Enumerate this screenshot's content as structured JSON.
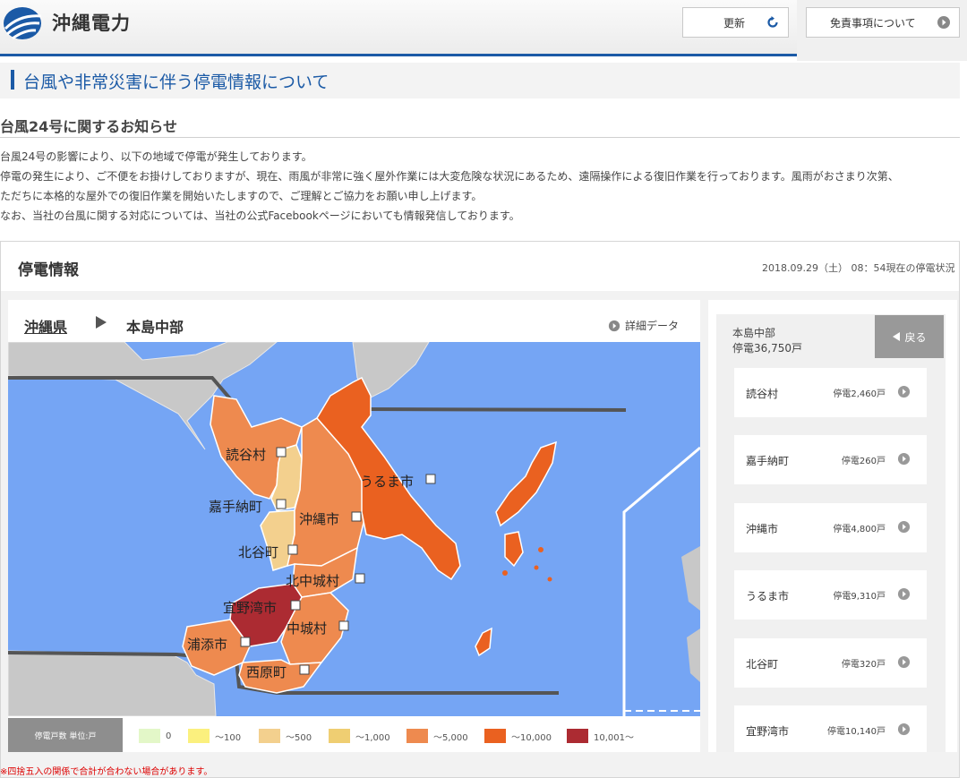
{
  "header": {
    "brand": "沖縄電力",
    "refresh_label": "更新",
    "disclaimer_label": "免責事項について"
  },
  "page_title": "台風や非常災害に伴う停電情報について",
  "notice": {
    "heading": "台風24号に関するお知らせ",
    "paragraphs": [
      "台風24号の影響により、以下の地域で停電が発生しております。",
      "停電の発生により、ご不便をお掛けしておりますが、現在、雨風が非常に強く屋外作業には大変危険な状況にあるため、遠隔操作による復旧作業を行っております。風雨がおさまり次第、",
      "ただちに本格的な屋外での復旧作業を開始いたしますので、ご理解とご協力をお願い申し上げます。",
      "なお、当社の台風に関する対応については、当社の公式Facebookページにおいても情報発信しております。"
    ]
  },
  "outage": {
    "title": "停電情報",
    "timestamp": "2018.09.29（土） 08：54現在の停電状況",
    "breadcrumb": {
      "prefecture": "沖縄県",
      "region": "本島中部"
    },
    "detail_label": "詳細データ",
    "map_labels": {
      "yomitan": "読谷村",
      "uruma": "うるま市",
      "kadena": "嘉手納町",
      "okinawa": "沖縄市",
      "chatan": "北谷町",
      "kitanakagusuku": "北中城村",
      "ginowan": "宜野湾市",
      "nakagusuku": "中城村",
      "urasoe": "浦添市",
      "nishihara": "西原町"
    },
    "legend": {
      "title": "停電戸数 単位:戸",
      "items": [
        {
          "label": "0",
          "color": "#e3f7c8"
        },
        {
          "label": "～100",
          "color": "#fbf07e"
        },
        {
          "label": "～500",
          "color": "#f3d08e"
        },
        {
          "label": "～1,000",
          "color": "#efce72"
        },
        {
          "label": "～5,000",
          "color": "#ee8a4f"
        },
        {
          "label": "～10,000",
          "color": "#ea6120"
        },
        {
          "label": "10,001～",
          "color": "#ac2b32"
        }
      ]
    },
    "footnote": "※四捨五入の関係で合計が合わない場合があります。",
    "side": {
      "region": "本島中部",
      "total": "停電36,750戸",
      "back_label": "戻る",
      "areas": [
        {
          "name": "読谷村",
          "count": "停電2,460戸"
        },
        {
          "name": "嘉手納町",
          "count": "停電260戸"
        },
        {
          "name": "沖縄市",
          "count": "停電4,800戸"
        },
        {
          "name": "うるま市",
          "count": "停電9,310戸"
        },
        {
          "name": "北谷町",
          "count": "停電320戸"
        },
        {
          "name": "宜野湾市",
          "count": "停電10,140戸"
        }
      ]
    }
  }
}
